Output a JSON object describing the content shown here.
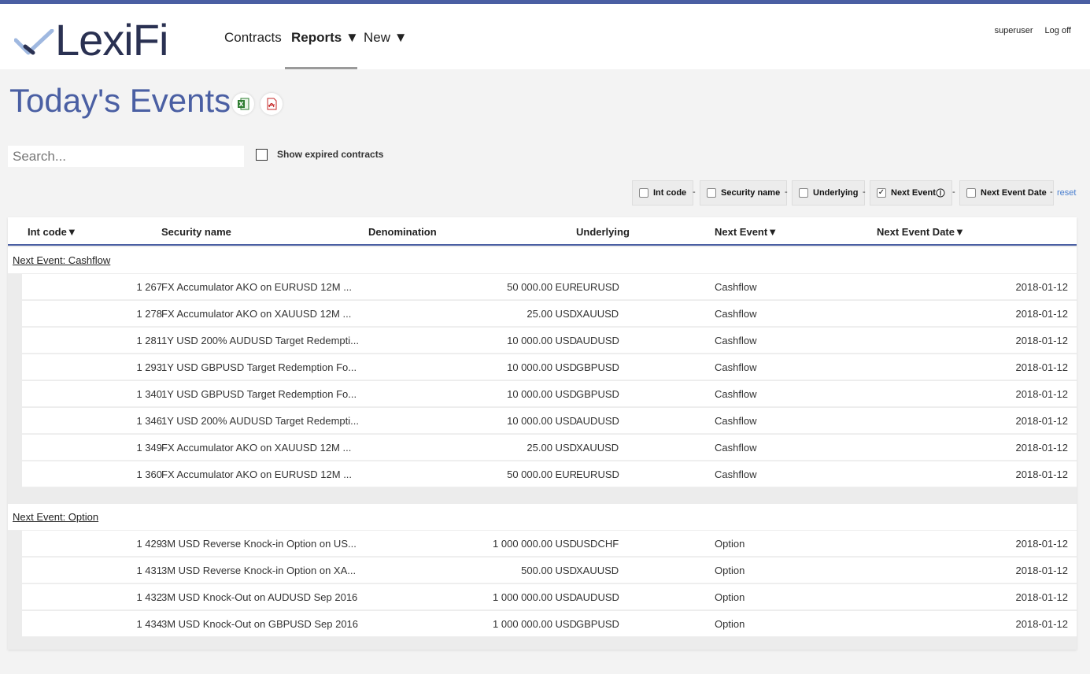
{
  "app": {
    "logo_text": "LexiFi",
    "accent_color": "#4a5fa3"
  },
  "nav": {
    "contracts": "Contracts",
    "reports": "Reports ▼",
    "new": "New ▼"
  },
  "user": {
    "name": "superuser",
    "logoff": "Log off"
  },
  "page": {
    "title": "Today's Events"
  },
  "filters": {
    "search_placeholder": "Search...",
    "show_expired_label": "Show expired contracts",
    "show_expired_checked": false
  },
  "sort_chips": [
    {
      "label": "Int code",
      "checked": false
    },
    {
      "label": "Security name",
      "checked": false
    },
    {
      "label": "Underlying",
      "checked": false
    },
    {
      "label": "Next Event",
      "checked": true
    },
    {
      "label": "Next Event Date",
      "checked": false
    }
  ],
  "sort_separator": "-",
  "reset_label": "reset",
  "columns": {
    "int_code": "Int code▼",
    "security_name": "Security name",
    "denomination": "Denomination",
    "underlying": "Underlying",
    "next_event": "Next Event▼",
    "next_event_date": "Next Event Date▼"
  },
  "groups": [
    {
      "title": "Next Event: Cashflow",
      "rows": [
        {
          "code": "1 267",
          "name": "FX Accumulator AKO on EURUSD 12M ...",
          "denom": "50 000.00 EUR",
          "underlying": "EURUSD",
          "event": "Cashflow",
          "date": "2018-01-12"
        },
        {
          "code": "1 278",
          "name": "FX Accumulator AKO on XAUUSD 12M ...",
          "denom": "25.00 USD",
          "underlying": "XAUUSD",
          "event": "Cashflow",
          "date": "2018-01-12"
        },
        {
          "code": "1 281",
          "name": "1Y USD 200% AUDUSD Target Redempti...",
          "denom": "10 000.00 USD",
          "underlying": "AUDUSD",
          "event": "Cashflow",
          "date": "2018-01-12"
        },
        {
          "code": "1 293",
          "name": "1Y USD GBPUSD Target Redemption Fo...",
          "denom": "10 000.00 USD",
          "underlying": "GBPUSD",
          "event": "Cashflow",
          "date": "2018-01-12"
        },
        {
          "code": "1 340",
          "name": "1Y USD GBPUSD Target Redemption Fo...",
          "denom": "10 000.00 USD",
          "underlying": "GBPUSD",
          "event": "Cashflow",
          "date": "2018-01-12"
        },
        {
          "code": "1 346",
          "name": "1Y USD 200% AUDUSD Target Redempti...",
          "denom": "10 000.00 USD",
          "underlying": "AUDUSD",
          "event": "Cashflow",
          "date": "2018-01-12"
        },
        {
          "code": "1 349",
          "name": "FX Accumulator AKO on XAUUSD 12M ...",
          "denom": "25.00 USD",
          "underlying": "XAUUSD",
          "event": "Cashflow",
          "date": "2018-01-12"
        },
        {
          "code": "1 360",
          "name": "FX Accumulator AKO on EURUSD 12M ...",
          "denom": "50 000.00 EUR",
          "underlying": "EURUSD",
          "event": "Cashflow",
          "date": "2018-01-12"
        }
      ]
    },
    {
      "title": "Next Event: Option",
      "rows": [
        {
          "code": "1 429",
          "name": "3M USD Reverse Knock-in Option on US...",
          "denom": "1 000 000.00 USD",
          "underlying": "USDCHF",
          "event": "Option",
          "date": "2018-01-12"
        },
        {
          "code": "1 431",
          "name": "3M USD Reverse Knock-in Option on XA...",
          "denom": "500.00 USD",
          "underlying": "XAUUSD",
          "event": "Option",
          "date": "2018-01-12"
        },
        {
          "code": "1 432",
          "name": "3M USD Knock-Out on AUDUSD Sep 2016",
          "denom": "1 000 000.00 USD",
          "underlying": "AUDUSD",
          "event": "Option",
          "date": "2018-01-12"
        },
        {
          "code": "1 434",
          "name": "3M USD Knock-Out on GBPUSD Sep 2016",
          "denom": "1 000 000.00 USD",
          "underlying": "GBPUSD",
          "event": "Option",
          "date": "2018-01-12"
        }
      ]
    }
  ]
}
